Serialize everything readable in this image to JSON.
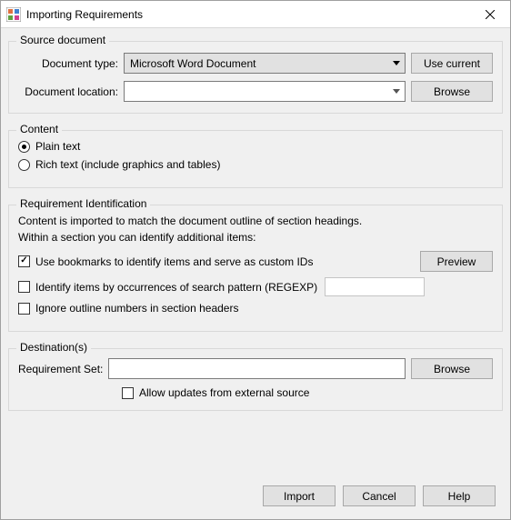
{
  "window": {
    "title": "Importing Requirements"
  },
  "source": {
    "legend": "Source document",
    "doc_type_label": "Document type:",
    "doc_type_value": "Microsoft Word Document",
    "use_current": "Use current",
    "doc_loc_label": "Document location:",
    "doc_loc_value": "",
    "browse": "Browse"
  },
  "content": {
    "legend": "Content",
    "plain": "Plain text",
    "rich": "Rich text (include graphics and tables)"
  },
  "reqid": {
    "legend": "Requirement Identification",
    "desc1": "Content is imported to match the document outline of section headings.",
    "desc2": "Within a section you can identify additional items:",
    "bookmarks": "Use bookmarks to identify items and serve as custom IDs",
    "preview": "Preview",
    "regex": "Identify items by occurrences of search pattern (REGEXP)",
    "ignore": "Ignore outline numbers in section headers"
  },
  "dest": {
    "legend": "Destination(s)",
    "set_label": "Requirement Set:",
    "set_value": "",
    "browse": "Browse",
    "allow": "Allow updates from external source"
  },
  "footer": {
    "import": "Import",
    "cancel": "Cancel",
    "help": "Help"
  }
}
